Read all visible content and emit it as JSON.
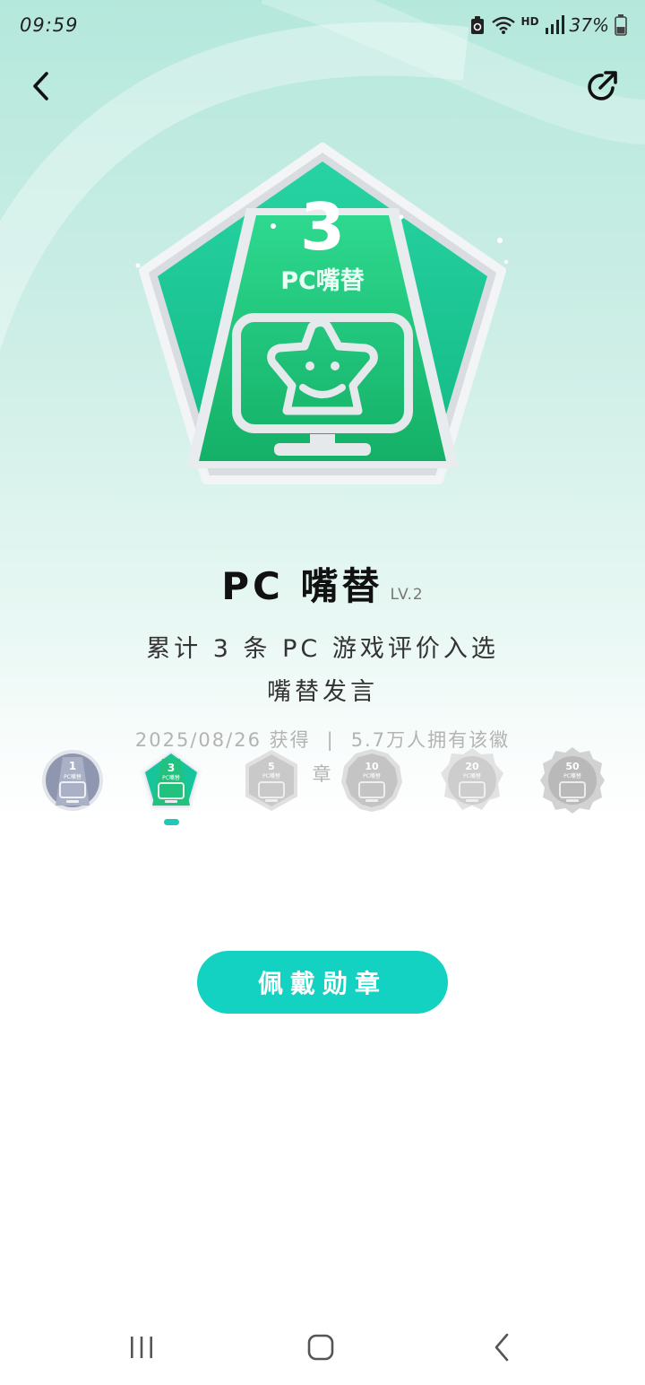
{
  "status_bar": {
    "time": "09:59",
    "network_label": "HD",
    "battery": "37%",
    "icons": [
      "recycle-icon",
      "wifi-icon",
      "signal-icon",
      "battery-icon"
    ]
  },
  "top_bar": {
    "back_icon": "chevron-left-icon",
    "share_icon": "share-icon"
  },
  "badge": {
    "level_number": "3",
    "label": "PC嘴替",
    "name": "PC 嘴替",
    "level": "LV.2",
    "description": "累计 3 条 PC 游戏评价入选嘴替发言",
    "obtained": "2025/08/26 获得",
    "separator": "|",
    "owners": "5.7万人拥有该徽章",
    "colors": {
      "primary": "#1fc98a",
      "accent": "#14d2c2",
      "frame": "#e6e9ec"
    }
  },
  "levels": [
    {
      "number": "1",
      "label": "PC嘴替",
      "state": "obtained",
      "color": "#8f97b0"
    },
    {
      "number": "3",
      "label": "PC嘴替",
      "state": "current",
      "color": "#22c27e"
    },
    {
      "number": "5",
      "label": "PC嘴替",
      "state": "locked",
      "color": "#c9c9c9"
    },
    {
      "number": "10",
      "label": "PC嘴替",
      "state": "locked",
      "color": "#c4c4c4"
    },
    {
      "number": "20",
      "label": "PC嘴替",
      "state": "locked",
      "color": "#cdcdcd"
    },
    {
      "number": "50",
      "label": "PC嘴替",
      "state": "locked",
      "color": "#b9b9b9"
    }
  ],
  "actions": {
    "wear_label": "佩戴勋章"
  },
  "nav_bar": {
    "icons": [
      "recent-apps-icon",
      "home-icon",
      "back-icon"
    ]
  }
}
